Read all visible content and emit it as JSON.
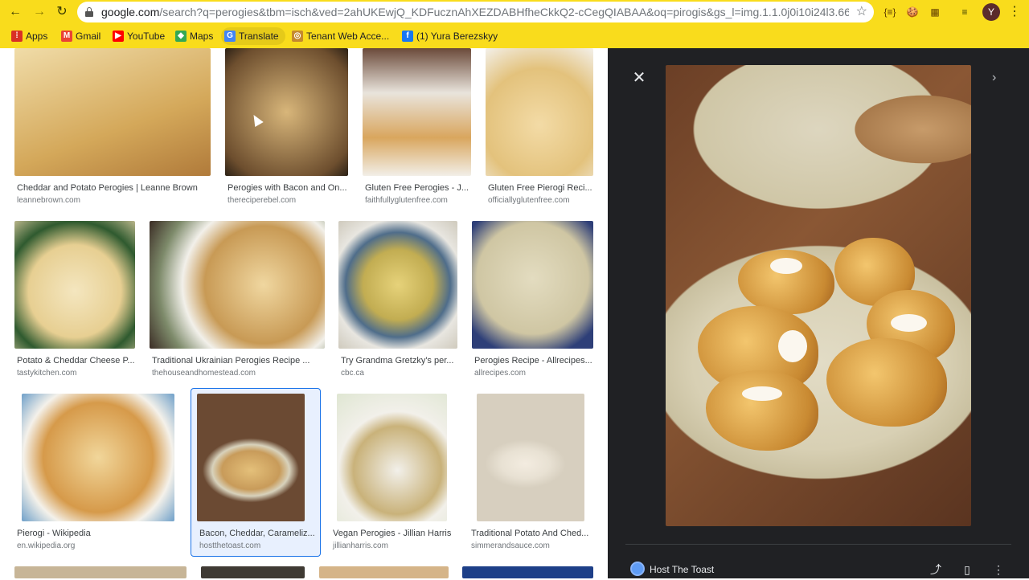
{
  "browser": {
    "url_host": "google.com",
    "url_rest": "/search?q=perogies&tbm=isch&ved=2ahUKEwjQ_KDFucznAhXEZDABHfheCkkQ2-cCegQIABAA&oq=pirogis&gs_l=img.1.1.0j0i10i24l3.660275.66...",
    "avatar_letter": "Y",
    "extensions": [
      "{≡}",
      "🍪",
      "▦"
    ],
    "bookmarks": [
      {
        "label": "Apps",
        "icon": "apps-grid-icon",
        "color": "#d93025"
      },
      {
        "label": "Gmail",
        "icon": "gmail-icon",
        "color": "#ea4335"
      },
      {
        "label": "YouTube",
        "icon": "youtube-icon",
        "color": "#ff0000"
      },
      {
        "label": "Maps",
        "icon": "maps-icon",
        "color": "#34a853"
      },
      {
        "label": "Translate",
        "icon": "translate-icon",
        "color": "#4285f4"
      },
      {
        "label": "Tenant Web Acce...",
        "icon": "tenant-icon",
        "color": "#c58a2e"
      },
      {
        "label": "(1) Yura Berezskyy",
        "icon": "facebook-icon",
        "color": "#1877f2"
      }
    ]
  },
  "results": [
    {
      "caption": "Cheddar and Potato Perogies | Leanne Brown",
      "source": "leannebrown.com",
      "color": "#d9b677"
    },
    {
      "caption": "Perogies with Bacon and On...",
      "source": "thereciperebel.com",
      "color": "#8c6d48"
    },
    {
      "caption": "Gluten Free Perogies - J...",
      "source": "faithfullyglutenfree.com",
      "color": "#c9a46a"
    },
    {
      "caption": "Gluten Free Pierogi Reci...",
      "source": "officiallyglutenfree.com",
      "color": "#e6cf9a"
    },
    {
      "caption": "Potato & Cheddar Cheese P...",
      "source": "tastykitchen.com",
      "color": "#e7d39e"
    },
    {
      "caption": "Traditional Ukrainian Perogies Recipe ...",
      "source": "thehouseandhomestead.com",
      "color": "#b58a52"
    },
    {
      "caption": "Try Grandma Gretzky's per...",
      "source": "cbc.ca",
      "color": "#c8c06a"
    },
    {
      "caption": "Perogies Recipe - Allrecipes...",
      "source": "allrecipes.com",
      "color": "#c9c0a0"
    },
    {
      "caption": "Pierogi - Wikipedia",
      "source": "en.wikipedia.org",
      "color": "#d7a25a"
    },
    {
      "caption": "Bacon, Cheddar, Carameliz...",
      "source": "hostthetoast.com",
      "color": "#8b6b4a"
    },
    {
      "caption": "Vegan Perogies - Jillian Harris",
      "source": "jillianharris.com",
      "color": "#d7c79a"
    },
    {
      "caption": "Traditional Potato And Ched...",
      "source": "simmerandsauce.com",
      "color": "#ece5d8"
    },
    {
      "caption": "",
      "source": "",
      "color": "#c7b597"
    },
    {
      "caption": "",
      "source": "",
      "color": "#3f3a33"
    },
    {
      "caption": "",
      "source": "",
      "color": "#d5b488"
    },
    {
      "caption": "",
      "source": "",
      "color": "#1d3f88"
    }
  ],
  "preview": {
    "source_name": "Host The Toast"
  }
}
